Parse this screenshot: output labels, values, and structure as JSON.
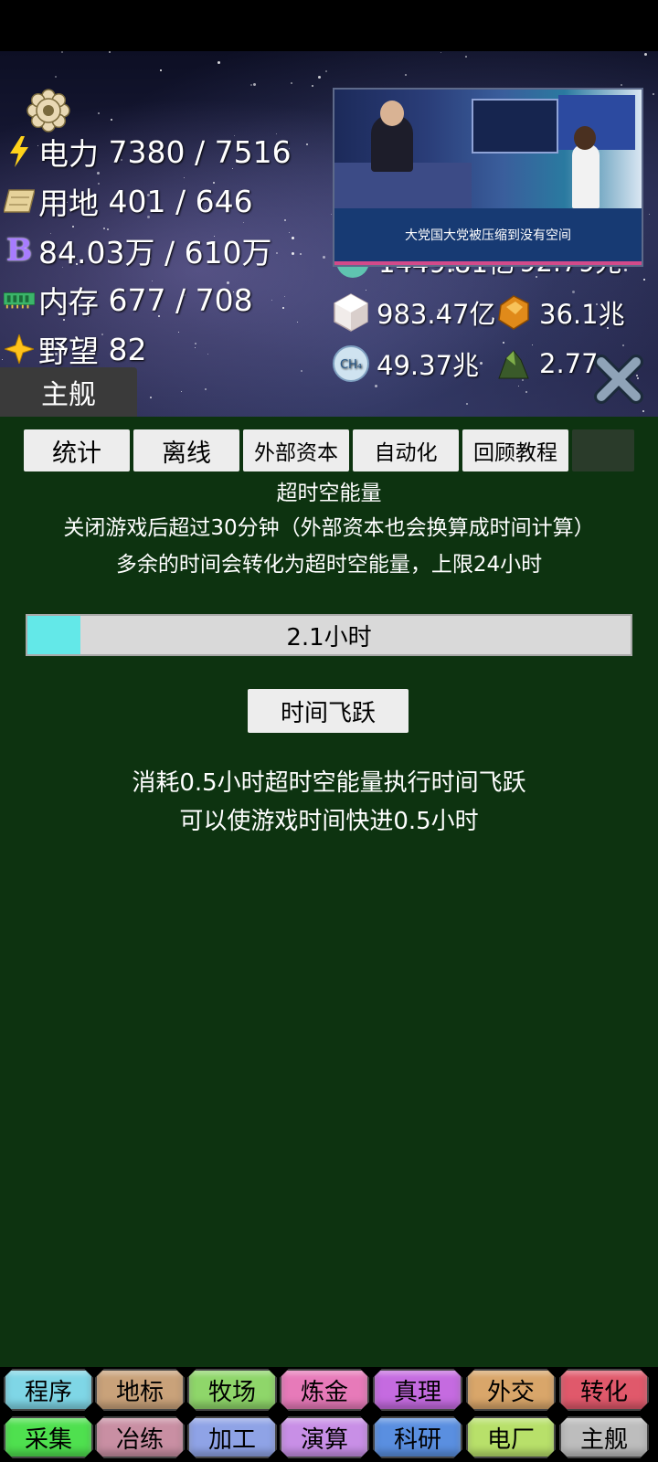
{
  "header": {
    "resources": [
      {
        "icon": "lightning-icon",
        "label": "电力",
        "value": "7380 / 7516"
      },
      {
        "icon": "land-scroll-icon",
        "label": "用地",
        "value": "401 / 646"
      },
      {
        "icon": "b-coin-icon",
        "label": "",
        "value": "84.03万 / 610万"
      },
      {
        "icon": "memory-chip-icon",
        "label": "内存",
        "value": "677 / 708"
      },
      {
        "icon": "star-icon",
        "label": "野望",
        "value": "82"
      }
    ],
    "right_resources": [
      {
        "icon": "partial-resource-icon",
        "value": "1449.81亿"
      },
      {
        "icon": "partial-resource-icon",
        "value": "92.79兆"
      },
      {
        "icon": "crystal-cube-icon",
        "value": "983.47亿"
      },
      {
        "icon": "amber-gem-icon",
        "value": "36.1兆"
      },
      {
        "icon": "ch4-icon",
        "icon_text": "CH₄",
        "value": "49.37兆"
      },
      {
        "icon": "ore-rock-icon",
        "value": "2.77"
      }
    ],
    "main_tab_label": "主舰",
    "video_subtitle": "大党国大党被压缩到没有空间"
  },
  "tabs": [
    {
      "label": "统计"
    },
    {
      "label": "离线"
    },
    {
      "label": "外部资本"
    },
    {
      "label": "自动化"
    },
    {
      "label": "回顾教程"
    }
  ],
  "offline": {
    "title": "超时空能量",
    "line1": "关闭游戏后超过30分钟（外部资本也会换算成时间计算）",
    "line2": "多余的时间会转化为超时空能量，上限24小时",
    "progress_label": "2.1小时",
    "progress_fraction": 0.0875,
    "jump_button": "时间飞跃",
    "desc1": "消耗0.5小时超时空能量执行时间飞跃",
    "desc2": "可以使游戏时间快进0.5小时"
  },
  "bottom_nav": {
    "row1": [
      {
        "label": "程序",
        "color": "#7fd6e6"
      },
      {
        "label": "地标",
        "color": "#c9a27a"
      },
      {
        "label": "牧场",
        "color": "#8fd66a"
      },
      {
        "label": "炼金",
        "color": "#e77ab9"
      },
      {
        "label": "真理",
        "color": "#c56be0"
      },
      {
        "label": "外交",
        "color": "#d9a66a"
      },
      {
        "label": "转化",
        "color": "#e0596b"
      }
    ],
    "row2": [
      {
        "label": "采集",
        "color": "#4fe04f"
      },
      {
        "label": "冶练",
        "color": "#c98fa3"
      },
      {
        "label": "加工",
        "color": "#8fa3e6"
      },
      {
        "label": "演算",
        "color": "#c88fe6"
      },
      {
        "label": "科研",
        "color": "#5a8fe0"
      },
      {
        "label": "电厂",
        "color": "#b8e06a"
      },
      {
        "label": "主舰",
        "color": "#bdbdbd"
      }
    ]
  }
}
